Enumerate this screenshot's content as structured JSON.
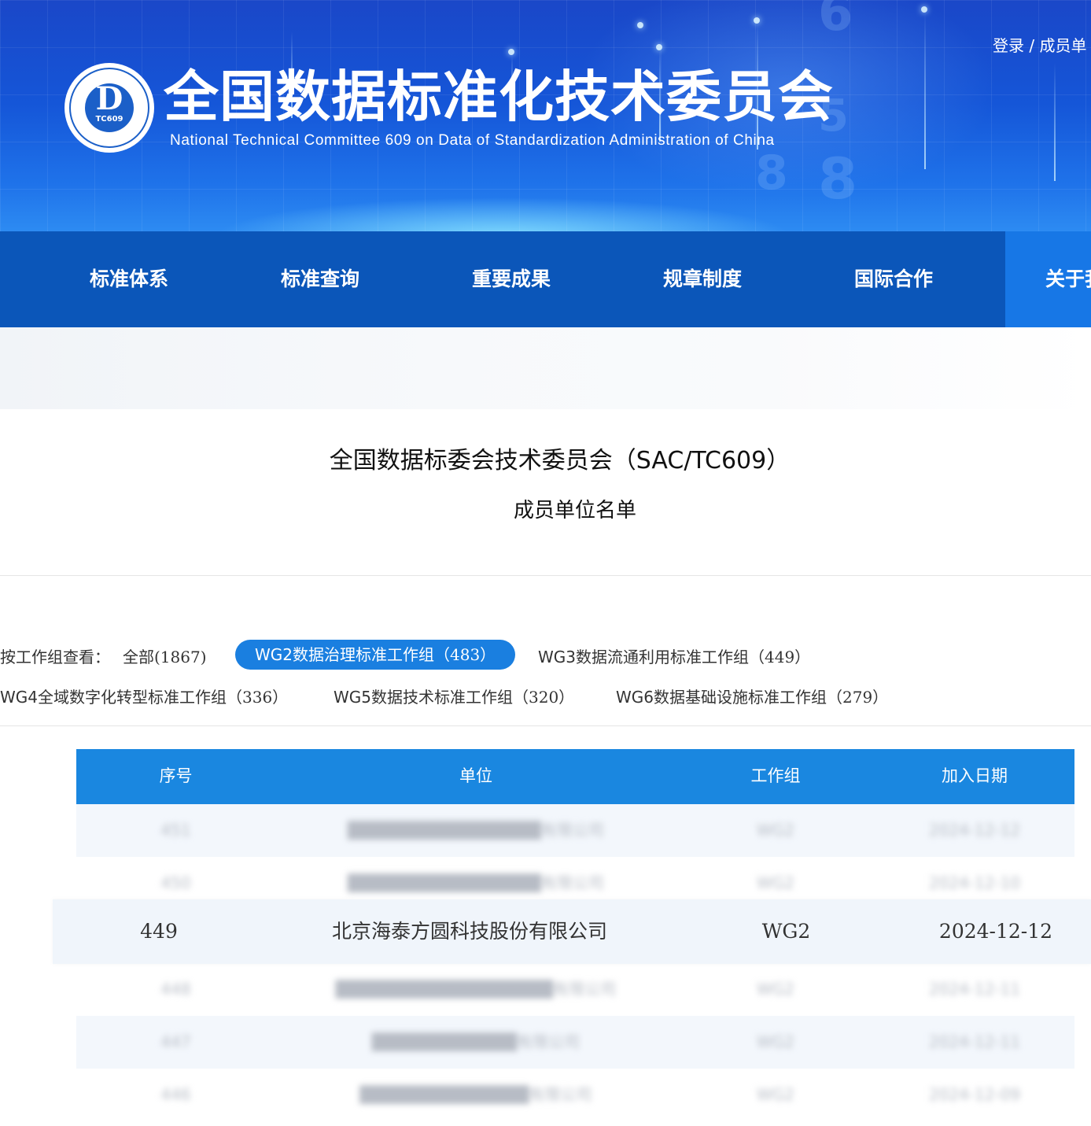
{
  "header": {
    "title_cn": "全国数据标准化技术委员会",
    "title_en": "National Technical Committee 609 on Data of Standardization Administration of China",
    "logo_d": "D",
    "logo_tc": "TC609",
    "login_label": "登录",
    "members_label": "成员单"
  },
  "nav": {
    "items": [
      {
        "label": "标准体系"
      },
      {
        "label": "标准查询"
      },
      {
        "label": "重要成果"
      },
      {
        "label": "规章制度"
      },
      {
        "label": "国际合作"
      },
      {
        "label": "关于我"
      }
    ],
    "active_index": 5
  },
  "page": {
    "title": "全国数据标委会技术委员会（SAC/TC609）",
    "subtitle": "成员单位名单"
  },
  "filters": {
    "label": "按工作组查看：",
    "all": {
      "name": "全部",
      "count": "(1867)"
    },
    "groups": [
      {
        "name": "WG2数据治理标准工作组",
        "count": "（483）",
        "active": true
      },
      {
        "name": "WG3数据流通利用标准工作组",
        "count": "（449）",
        "active": false
      },
      {
        "name": "WG4全域数字化转型标准工作组",
        "count": "（336）",
        "active": false
      },
      {
        "name": "WG5数据技术标准工作组",
        "count": "（320）",
        "active": false
      },
      {
        "name": "WG6数据基础设施标准工作组",
        "count": "（279）",
        "active": false
      }
    ]
  },
  "table": {
    "columns": [
      "序号",
      "单位",
      "工作组",
      "加入日期"
    ],
    "rows": [
      {
        "no": "451",
        "unit": "████████████████有限公司",
        "group": "WG2",
        "date": "2024-12-12",
        "blurred": true
      },
      {
        "no": "450",
        "unit": "████████████████有限公司",
        "group": "WG2",
        "date": "2024-12-10",
        "blurred": true
      },
      {
        "no": "449",
        "unit": "北京海泰方圆科技股份有限公司",
        "group": "WG2",
        "date": "2024-12-12",
        "blurred": false
      },
      {
        "no": "448",
        "unit": "██████████████████有限公司",
        "group": "WG2",
        "date": "2024-12-11",
        "blurred": true
      },
      {
        "no": "447",
        "unit": "████████████有限公司",
        "group": "WG2",
        "date": "2024-12-11",
        "blurred": true
      },
      {
        "no": "446",
        "unit": "██████████████有限公司",
        "group": "WG2",
        "date": "2024-12-09",
        "blurred": true
      }
    ]
  },
  "colors": {
    "nav_bg": "#0b56b9",
    "nav_active": "#1777e6",
    "accent": "#1a7fe0",
    "table_header": "#1a87e0"
  }
}
